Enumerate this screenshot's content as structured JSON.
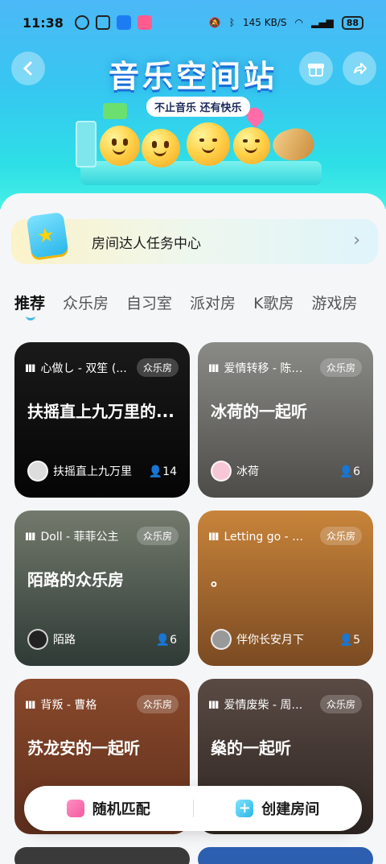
{
  "status": {
    "time": "11:38",
    "net_speed": "145 KB/S",
    "battery": "88"
  },
  "hero": {
    "title": "音乐空间站",
    "subtitle": "不止音乐 还有快乐"
  },
  "task": {
    "label": "房间达人任务中心"
  },
  "tabs": [
    "推荐",
    "众乐房",
    "自习室",
    "派对房",
    "K歌房",
    "游戏房"
  ],
  "cards": [
    {
      "song": "心做し - 双笙 (...",
      "badge": "众乐房",
      "title": "扶摇直上九万里的...",
      "owner": "扶摇直上九万里",
      "count": "14",
      "bg": "#0b0b0b"
    },
    {
      "song": "爱情转移 - 陈奕迅",
      "badge": "众乐房",
      "title": "冰荷的一起听",
      "owner": "冰荷",
      "count": "6",
      "bg": "#6f6f6b"
    },
    {
      "song": "Doll - 菲菲公主",
      "badge": "众乐房",
      "title": "陌路的众乐房",
      "owner": "陌路",
      "count": "6",
      "bg": "#4f5a52"
    },
    {
      "song": "Letting go - 蔡...",
      "badge": "众乐房",
      "title": "。",
      "owner": "伴你长安月下",
      "count": "5",
      "bg": "#b9742d"
    },
    {
      "song": "背叛 - 曹格",
      "badge": "众乐房",
      "title": "苏龙安的一起听",
      "owner": "",
      "count": "",
      "bg": "#7b3f26"
    },
    {
      "song": "爱情废柴 - 周杰伦",
      "badge": "众乐房",
      "title": "燊的一起听",
      "owner": "",
      "count": "",
      "bg": "#4a3a36"
    }
  ],
  "bottom": {
    "random": "随机匹配",
    "create": "创建房间"
  }
}
